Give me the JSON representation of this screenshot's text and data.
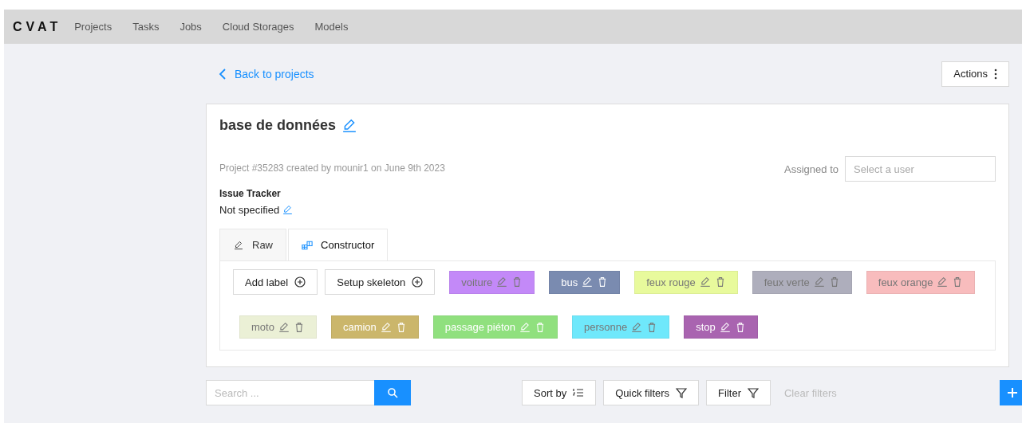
{
  "header": {
    "logo": "CVAT",
    "nav": [
      {
        "label": "Projects"
      },
      {
        "label": "Tasks"
      },
      {
        "label": "Jobs"
      },
      {
        "label": "Cloud Storages"
      },
      {
        "label": "Models"
      }
    ]
  },
  "back_link": "Back to projects",
  "actions_button": "Actions",
  "project": {
    "title": "base de données",
    "meta": "Project #35283 created by mounir1 on June 9th 2023",
    "assigned_label": "Assigned to",
    "assignee": {
      "placeholder": "Select a user"
    },
    "issue_tracker_label": "Issue Tracker",
    "issue_tracker_value": "Not specified"
  },
  "tabs": [
    {
      "label": "Raw",
      "kind": "raw",
      "selected": false
    },
    {
      "label": "Constructor",
      "kind": "constructor",
      "selected": true
    }
  ],
  "constructor_buttons": [
    "Add label",
    "Setup skeleton"
  ],
  "labels": [
    {
      "name": "voiture",
      "color": "#c389f8",
      "kind": "muted"
    },
    {
      "name": "bus",
      "color": "#7a8bb0",
      "kind": "contrast"
    },
    {
      "name": "feux rouge",
      "color": "#e8fa9c",
      "kind": "muted"
    },
    {
      "name": "feux verte",
      "color": "#aeaebc",
      "kind": "muted"
    },
    {
      "name": "feux orange",
      "color": "#f8bcbd",
      "kind": "muted"
    },
    {
      "name": "moto",
      "color": "#ebf0d6",
      "kind": "muted"
    },
    {
      "name": "camion",
      "color": "#cbb66b",
      "kind": "contrast"
    },
    {
      "name": "passage piéton",
      "color": "#90e07e",
      "kind": "contrast"
    },
    {
      "name": "personne",
      "color": "#6fe8fb",
      "kind": "muted"
    },
    {
      "name": "stop",
      "color": "#a964b0",
      "kind": "contrast"
    }
  ],
  "toolbar": {
    "search": {
      "placeholder": "Search ..."
    },
    "sort_button": "Sort by",
    "quick_filters_button": "Quick filters",
    "filter_button": "Filter",
    "clear_filters": "Clear filters"
  }
}
